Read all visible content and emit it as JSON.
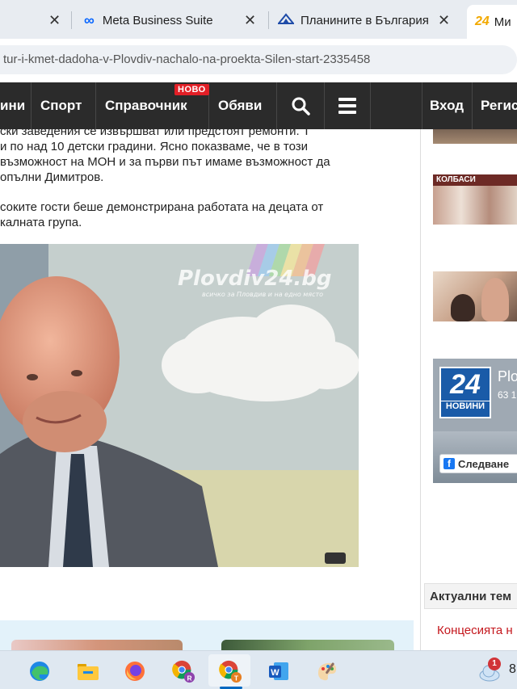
{
  "browser": {
    "tabs": [
      {
        "label": "",
        "close": "✕"
      },
      {
        "label": "Meta Business Suite",
        "close": "✕"
      },
      {
        "label": "Планините в България и",
        "close": "✕"
      },
      {
        "label": "Ми",
        "close": ""
      }
    ],
    "url": "tur-i-kmet-dadoha-v-Plovdiv-nachalo-na-proekta-Silen-start-2335458"
  },
  "nav": {
    "items": [
      "ини",
      "Спорт",
      "Справочник",
      "Обяви",
      "Вход",
      "Регис"
    ],
    "badge": "НОВО"
  },
  "article": {
    "lines1": [
      "ски заведения се извършват или предстоят ремонти. Т",
      "и по над 10 детски градини. Ясно показваме, че в този",
      "възможност на МОН и за първи път имаме възможност да",
      "опълни Димитров."
    ],
    "lines2": [
      "соките гости беше демонстрирана работата на децата от",
      "калната група."
    ],
    "watermark": "Plovdiv24.bg",
    "watermark_sub": "всичко за Пловдив и на едно място"
  },
  "sidebar": {
    "thumb2_sign": "КОЛБАСИ",
    "fb_logo_number": "24",
    "fb_logo_word": "НОВИНИ",
    "fb_name": "Plo",
    "fb_count": "63 1",
    "fb_follow": "Следване",
    "topics_title": "Актуални тем",
    "topics_first": "Концесията н"
  },
  "taskbar": {
    "notification_count": "1",
    "clock_partial": "8"
  },
  "colors": {
    "accent_red": "#e21f26",
    "nav_bg": "#2b2b2b",
    "facebook_blue": "#1877f2"
  }
}
